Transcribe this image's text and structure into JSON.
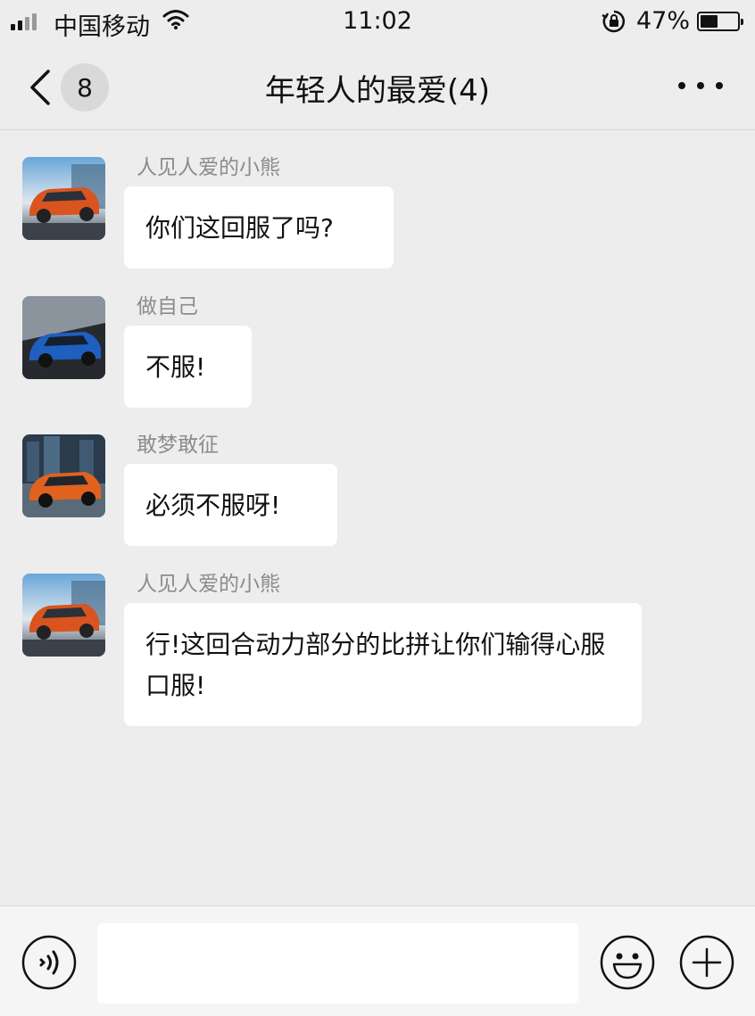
{
  "status_bar": {
    "carrier": "中国移动",
    "time": "11:02",
    "battery_percent": "47%",
    "battery_level": 0.47
  },
  "nav": {
    "back_icon": "chevron-left-icon",
    "unread_count": "8",
    "title": "年轻人的最爱(4)",
    "more_icon": "more-dots-icon"
  },
  "messages": [
    {
      "sender": "人见人爱的小熊",
      "text": "你们这回服了吗?",
      "avatar": "orange-suv-avatar"
    },
    {
      "sender": "做自己",
      "text": "不服!",
      "avatar": "blue-suv-avatar"
    },
    {
      "sender": "敢梦敢征",
      "text": "必须不服呀!",
      "avatar": "orange-suv-city-avatar"
    },
    {
      "sender": "人见人爱的小熊",
      "text": "行!这回合动力部分的比拼让你们输得心服口服!",
      "avatar": "orange-suv-avatar"
    }
  ],
  "input_bar": {
    "voice_icon": "voice-icon",
    "input_value": "",
    "emoji_icon": "emoji-icon",
    "plus_icon": "plus-icon"
  },
  "colors": {
    "background": "#ededed",
    "bubble": "#ffffff",
    "sender_name": "#8c8c8c"
  }
}
